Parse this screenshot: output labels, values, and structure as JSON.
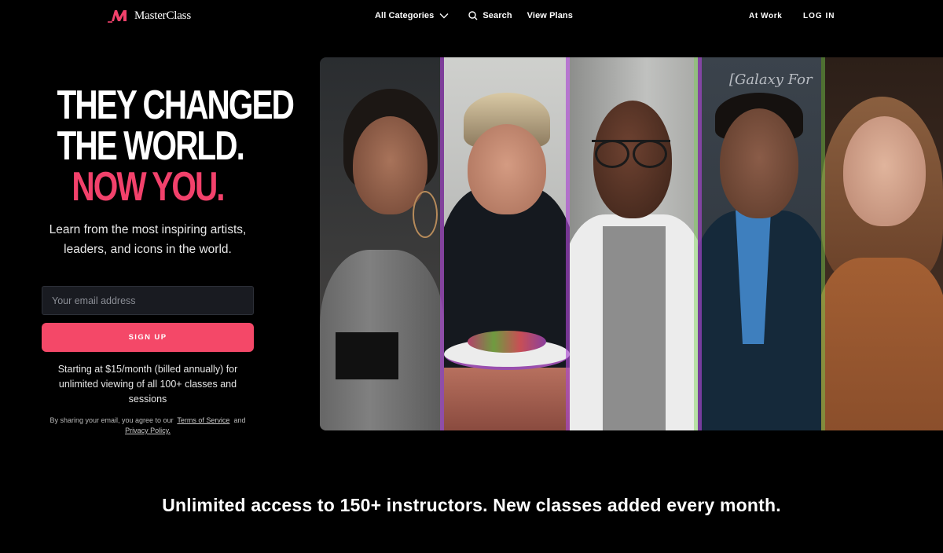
{
  "header": {
    "brand": "MasterClass",
    "nav": {
      "categories": "All Categories",
      "search": "Search",
      "plans": "View Plans",
      "at_work": "At Work",
      "login": "LOG IN"
    }
  },
  "hero": {
    "headline": [
      "THEY CHANGED",
      "THE WORLD.",
      "NOW YOU."
    ],
    "subhead": "Learn from the most inspiring artists, leaders, and icons in the world.",
    "email_placeholder": "Your email address",
    "email_value": "",
    "signup_label": "SIGN UP",
    "pricing": "Starting at $15/month (billed annually) for unlimited viewing of all 100+ classes and sessions",
    "legal_prefix": "By sharing your email, you agree to our",
    "terms_label": "Terms of Service",
    "legal_and": "and",
    "privacy_label": "Privacy Policy."
  },
  "collage": {
    "panels": [
      {
        "label": "instructor-portrait-singer"
      },
      {
        "label": "instructor-portrait-chef"
      },
      {
        "label": "instructor-portrait-actor"
      },
      {
        "label": "instructor-portrait-astrophysicist"
      },
      {
        "label": "instructor-portrait-actress"
      }
    ],
    "chalkboard_text": "[Galaxy For"
  },
  "tagline": "Unlimited access to 150+ instructors. New classes added every month.",
  "colors": {
    "accent": "#f2416b",
    "button": "#f44868",
    "background": "#000000",
    "input_bg": "#191b21"
  }
}
